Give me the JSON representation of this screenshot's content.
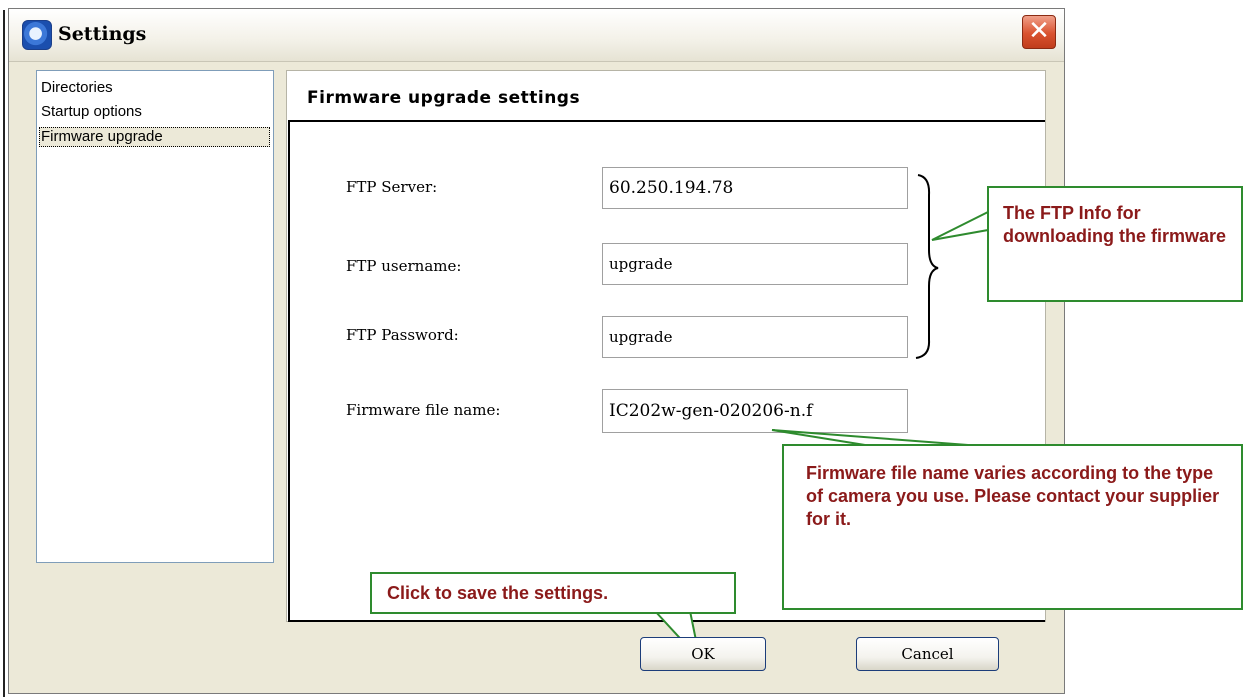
{
  "window": {
    "title": "Settings",
    "close_label": "✕"
  },
  "sidebar": {
    "items": [
      {
        "label": "Directories"
      },
      {
        "label": "Startup options"
      },
      {
        "label": "Firmware upgrade"
      }
    ],
    "selected_index": 2
  },
  "panel": {
    "title": "Firmware upgrade settings",
    "fields": [
      {
        "label": "FTP Server:",
        "value": "60.250.194.78"
      },
      {
        "label": "FTP username:",
        "value": "upgrade"
      },
      {
        "label": "FTP Password:",
        "value": "upgrade"
      },
      {
        "label": "Firmware file name:",
        "value": "IC202w-gen-020206-n.f"
      }
    ]
  },
  "buttons": {
    "ok": "OK",
    "cancel": "Cancel"
  },
  "callouts": {
    "ftp_info": "The FTP Info for downloading the firmware",
    "firmware_name": "Firmware file name varies according to the type of camera you use. Please contact your supplier for it.",
    "save": "Click to save the settings."
  },
  "colors": {
    "callout_border": "#2e8b2e",
    "callout_text": "#8b1a1a",
    "window_bg": "#ece9d8"
  }
}
